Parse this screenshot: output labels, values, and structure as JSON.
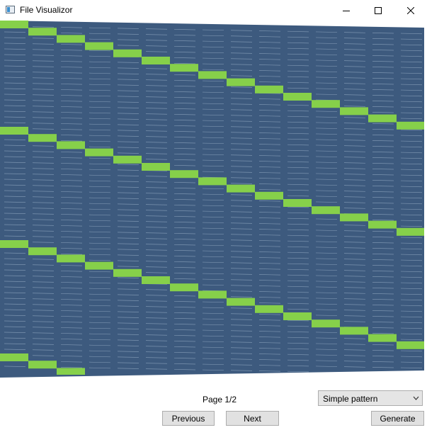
{
  "window": {
    "title": "File Visualizor",
    "icon": "app-window-icon",
    "controls": [
      "minimize-icon",
      "maximize-icon",
      "close-icon"
    ]
  },
  "visualization": {
    "background_color": "#3d5a7e",
    "line_color": "#8fa6bf",
    "highlight_color": "#86d04a",
    "pattern": "diagonal-stepped-bands"
  },
  "footer": {
    "page_label": "Page 1/2",
    "pattern_select": {
      "value": "Simple pattern"
    },
    "previous_label": "Previous",
    "next_label": "Next",
    "generate_label": "Generate"
  }
}
